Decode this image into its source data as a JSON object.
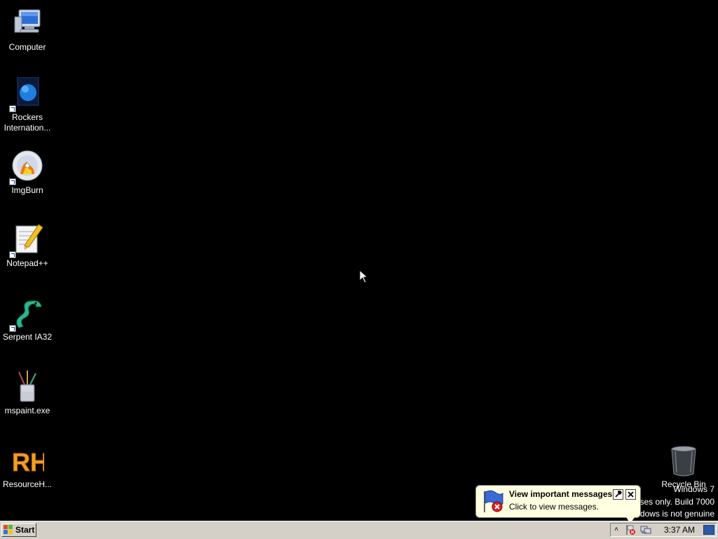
{
  "desktop_icons": [
    {
      "label": "Computer",
      "icon": "computer-icon"
    },
    {
      "label": "Rockers Internation...",
      "icon": "globe-icon"
    },
    {
      "label": "ImgBurn",
      "icon": "disc-burn-icon"
    },
    {
      "label": "Notepad++",
      "icon": "notepad-icon"
    },
    {
      "label": "Serpent IA32",
      "icon": "serpent-icon"
    },
    {
      "label": "mspaint.exe",
      "icon": "paint-icon"
    },
    {
      "label": "ResourceH...",
      "icon": "resource-hacker-icon"
    },
    {
      "label": "Recycle Bin",
      "icon": "recycle-bin-icon"
    }
  ],
  "watermark": {
    "line1": "Windows 7",
    "line2": "ses only. Build 7000",
    "line3": "dows is not genuine"
  },
  "balloon": {
    "title": "View important messages",
    "subtitle": "Click to view messages."
  },
  "taskbar": {
    "start_label": "Start",
    "clock": "3:37 AM"
  },
  "colors": {
    "desktop_bg": "#000000",
    "taskbar_bg": "#d4d0c8",
    "balloon_bg": "#ffffe1"
  }
}
